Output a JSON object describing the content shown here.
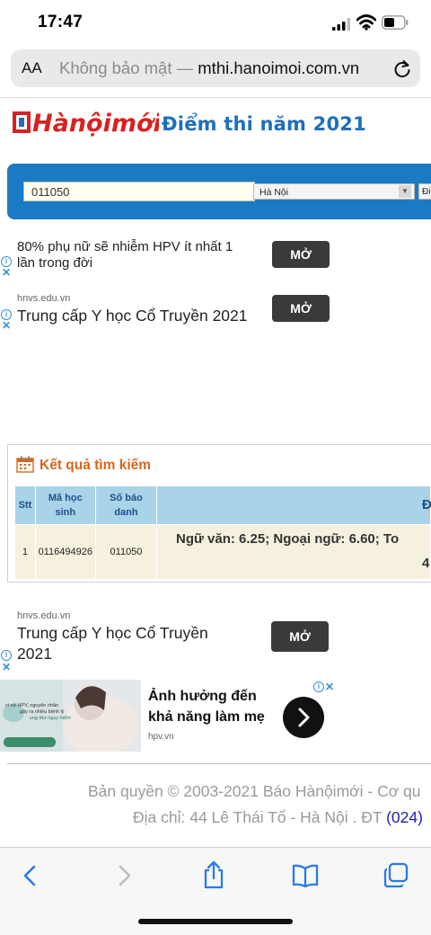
{
  "status": {
    "time": "17:47"
  },
  "browser": {
    "aa": "AA",
    "security": "Không bảo mật —",
    "domain": "mthi.hanoimoi.com.vn"
  },
  "header": {
    "logo_text": "Hànộimới",
    "title": "Điểm thi năm 2021"
  },
  "search": {
    "sbd_value": "011050",
    "city_value": "Hà Nội",
    "second_select": "Đi"
  },
  "ads": {
    "ad1": {
      "text": "80% phụ nữ sẽ nhiễm HPV ít nhất 1 lần trong đời",
      "button": "MỞ"
    },
    "ad2": {
      "domain": "hnvs.edu.vn",
      "text": "Trung cấp Y học Cổ Truyền 2021",
      "button": "MỞ"
    },
    "ad3": {
      "domain": "hnvs.edu.vn",
      "text_line1": "Trung cấp Y học Cổ Truyền",
      "text_line2": "2021",
      "button": "MỞ"
    },
    "ad4": {
      "headline_line1": "Ảnh hưởng đến",
      "headline_line2": "khả năng làm mẹ",
      "domain": "hpv.vn",
      "img_text_1": "vi rút HPV, nguyên nhân",
      "img_text_2": "gây ra nhiều bệnh lý",
      "img_text_3": "ung thư nguy hiểm"
    }
  },
  "results": {
    "title": "Kết quả tìm kiếm",
    "columns": [
      "Stt",
      "Mã học sinh",
      "Số báo danh",
      "Đ"
    ],
    "rows": [
      {
        "stt": "1",
        "ma_hoc_sinh": "0116494926",
        "so_bao_danh": "011050",
        "scores": "Ngữ văn: 6.25; Ngoại ngữ: 6.60; To",
        "scores_cont": "4"
      }
    ]
  },
  "footer": {
    "line1": "Bản quyền © 2003-2021 Báo Hànộimới - Cơ qu",
    "line2_text": "Địa chỉ: 44 Lê Thái Tổ - Hà Nội . ĐT",
    "line2_phone": "(024)"
  },
  "colors": {
    "brand_blue": "#1a7bc4",
    "result_orange": "#d9661a",
    "table_header": "#a9d3e8",
    "table_row": "#f6f1de",
    "ad_button": "#3a3a3c",
    "toolbar_icon": "#2a7be4"
  },
  "icons": {
    "toolbar": [
      "back-icon",
      "forward-icon",
      "share-icon",
      "bookmarks-icon",
      "tabs-icon"
    ]
  }
}
